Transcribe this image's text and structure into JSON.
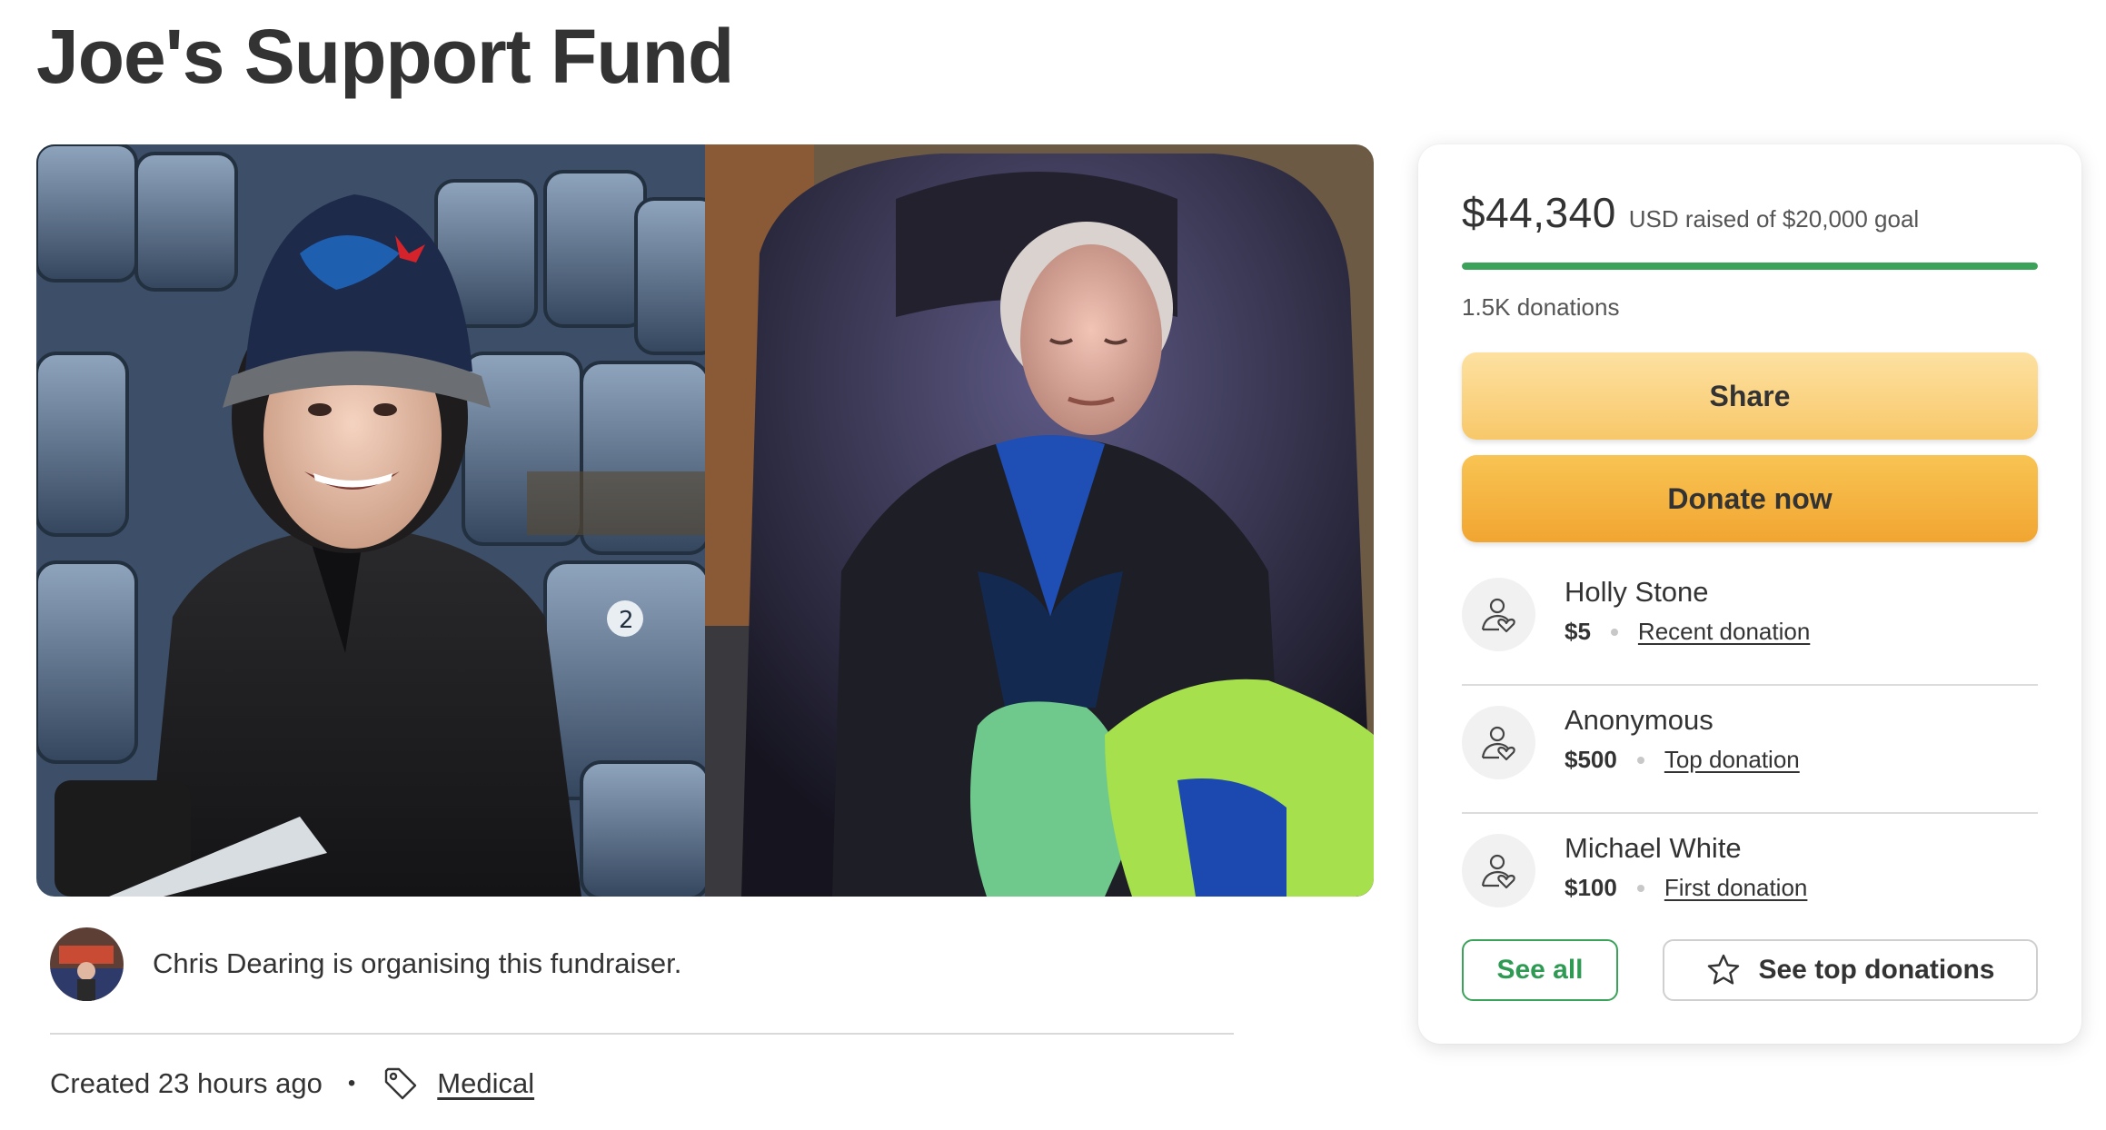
{
  "page": {
    "title": "Joe's Support Fund"
  },
  "hero": {
    "photos": [
      {
        "name": "photo-joe-stadium"
      },
      {
        "name": "photo-joe-sleeping"
      }
    ]
  },
  "organiser": {
    "text": "Chris Dearing is organising this fundraiser."
  },
  "meta": {
    "created": "Created 23 hours ago",
    "separator": "•",
    "category": "Medical",
    "category_icon": "tag-icon"
  },
  "summary": {
    "amount": "$44,340",
    "goal_text": "USD raised of $20,000 goal",
    "progress_fraction": 1.0,
    "progress_color": "#3aa259",
    "donations": "1.5K donations"
  },
  "buttons": {
    "share": "Share",
    "donate": "Donate now",
    "see_all": "See all",
    "see_top": "See top donations",
    "see_top_icon": "star-icon"
  },
  "donors": [
    {
      "name": "Holly Stone",
      "amount": "$5",
      "tag": "Recent donation"
    },
    {
      "name": "Anonymous",
      "amount": "$500",
      "tag": "Top donation"
    },
    {
      "name": "Michael White",
      "amount": "$100",
      "tag": "First donation"
    }
  ],
  "colors": {
    "accent_green": "#3aa259",
    "share_button": "#fad58a",
    "donate_button": "#f4b543"
  }
}
